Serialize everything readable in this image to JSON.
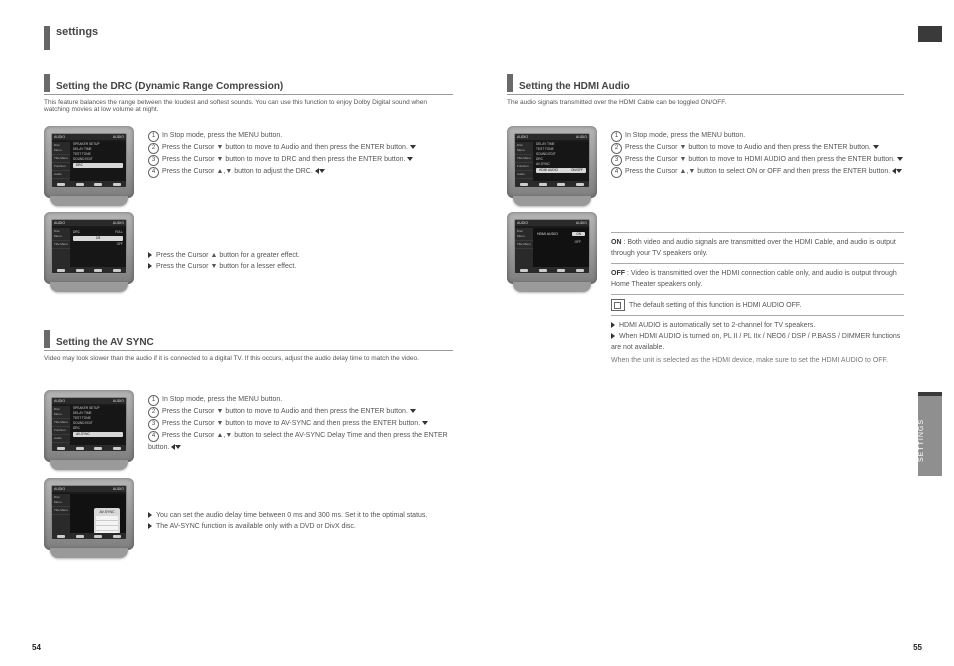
{
  "page_numbers": {
    "left": "54",
    "right": "55"
  },
  "side_tab_label": "SETTINGS",
  "heading_main": "settings",
  "left_page": {
    "section1": {
      "title": "Setting the DRC (Dynamic Range Compression)",
      "intro": "This feature balances the range between the loudest and softest sounds. You can use this function to enjoy Dolby Digital sound when watching movies at low volume at night.",
      "steps": [
        "In Stop mode, press the MENU button.",
        "Press the Cursor ▼ button to move to Audio and then press the ENTER button.",
        "Press the Cursor ▼ button to move to DRC and then press the ENTER button.",
        "Press the Cursor ▲,▼ button to adjust the DRC."
      ],
      "bullets": [
        "Press the Cursor ▲ button for a greater effect.",
        "Press the Cursor ▼ button for a lesser effect."
      ],
      "menu_items": [
        "SPEAKER SETUP",
        "DELAY TIME",
        "TEST TONE",
        "SOUND EDIT",
        "DRC"
      ],
      "menu_value_drc": "",
      "slider_popup": {
        "title": "DRC",
        "top": "FULL",
        "mid": "2/8",
        "bottom": "OFF"
      }
    },
    "section2": {
      "title": "Setting the AV SYNC",
      "intro": "Video may look slower than the audio if it is connected to a digital TV. If this occurs, adjust the audio delay time to match the video.",
      "steps": [
        "In Stop mode, press the MENU button.",
        "Press the Cursor ▼ button to move to Audio and then press the ENTER button.",
        "Press the Cursor ▼ button to move to AV-SYNC and then press the ENTER button.",
        "Press the Cursor ▲,▼ button to select the AV-SYNC Delay Time and then press the ENTER button."
      ],
      "bullets": [
        "You can set the audio delay time between 0 ms and 300 ms. Set it to the optimal status.",
        "The AV-SYNC function is available only with a DVD or DivX disc."
      ],
      "menu_items": [
        "SPEAKER SETUP",
        "DELAY TIME",
        "TEST TONE",
        "SOUND EDIT",
        "DRC",
        "AV-SYNC"
      ],
      "popup_title": "AV-SYNC"
    }
  },
  "right_page": {
    "section1": {
      "title": "Setting the HDMI Audio",
      "intro": "The audio signals transmitted over the HDMI Cable can be toggled ON/OFF.",
      "steps": [
        "In Stop mode, press the MENU button.",
        "Press the Cursor ▼ button to move to Audio and then press the ENTER button.",
        "Press the Cursor ▼ button to move to HDMI AUDIO and then press the ENTER button.",
        "Press the Cursor ▲,▼ button to select ON or OFF and then press the ENTER button."
      ],
      "options": [
        {
          "label": "ON",
          "desc": "Both video and audio signals are transmitted over the HDMI Cable, and audio is output through your TV speakers only."
        },
        {
          "label": "OFF",
          "desc": "Video is transmitted over the HDMI connection cable only, and audio is output through Home Theater speakers only."
        }
      ],
      "note_icon_label": "note",
      "notes": [
        "The default setting of this function is HDMI AUDIO OFF.",
        "HDMI AUDIO is automatically set to 2-channel for TV speakers.",
        "When HDMI AUDIO is turned on, PL II / PL IIx / NEO6 / DSP / P.BASS / DIMMER functions are not available.",
        "When the unit is selected as the HDMI device, make sure to set the HDMI AUDIO to OFF."
      ],
      "menu_items": [
        "DELAY TIME",
        "TEST TONE",
        "SOUND EDIT",
        "DRC",
        "AV-SYNC",
        "HDMI AUDIO"
      ],
      "menu_value_hdmi": "ON/OFF",
      "popup_title": "HDMI AUDIO",
      "popup_options": [
        "ON",
        "OFF"
      ]
    }
  },
  "tv_sidebar": [
    "Disc Menu",
    "Title Menu",
    "Function",
    "Audio"
  ],
  "tv_header_left": "AUDIO",
  "tv_header_right": "AUDIO"
}
